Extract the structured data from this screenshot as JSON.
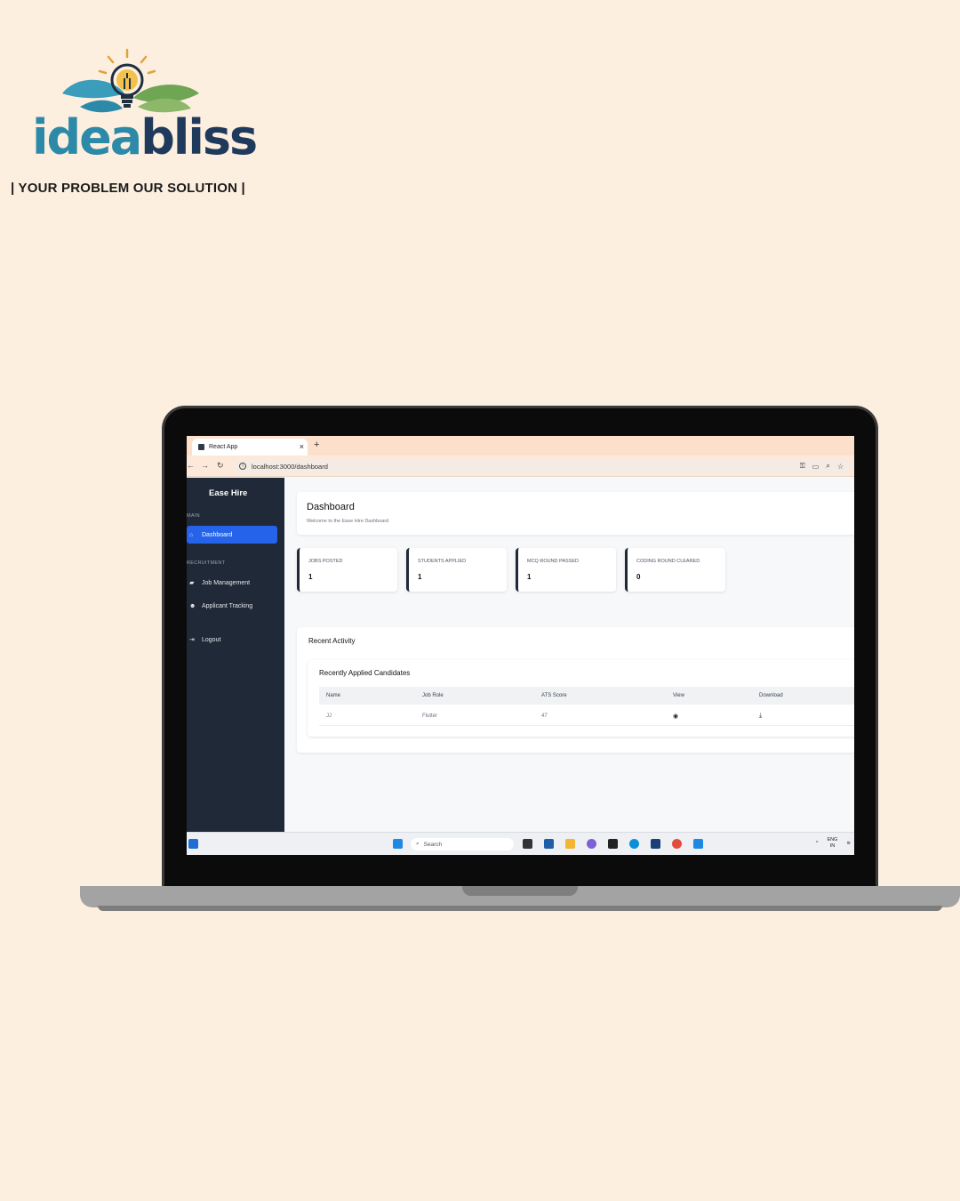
{
  "logo": {
    "word_part1": "idea",
    "word_part2": "bliss",
    "tagline": "| YOUR PROBLEM OUR SOLUTION |"
  },
  "browser": {
    "tab_title": "React App",
    "url": "localhost:3000/dashboard"
  },
  "sidebar": {
    "brand": "Ease Hire",
    "section_main": "MAIN",
    "section_recruitment": "RECRUITMENT",
    "items": [
      {
        "label": "Dashboard",
        "icon": "home-icon"
      },
      {
        "label": "Job Management",
        "icon": "briefcase-icon"
      },
      {
        "label": "Applicant Tracking",
        "icon": "users-icon"
      },
      {
        "label": "Logout",
        "icon": "logout-icon"
      }
    ]
  },
  "header": {
    "title": "Dashboard",
    "subtitle": "Welcome to the Ease Hire Dashboard"
  },
  "stats": [
    {
      "label": "JOBS POSTED",
      "value": "1"
    },
    {
      "label": "STUDENTS APPLIED",
      "value": "1"
    },
    {
      "label": "MCQ ROUND PASSED",
      "value": "1"
    },
    {
      "label": "CODING ROUND CLEARED",
      "value": "0"
    }
  ],
  "activity": {
    "title": "Recent Activity",
    "table_title": "Recently Applied Candidates",
    "columns": [
      "Name",
      "Job Role",
      "ATS Score",
      "View",
      "Download"
    ],
    "rows": [
      {
        "name": "JJ",
        "job_role": "Flutter",
        "ats_score": "47"
      }
    ]
  },
  "taskbar": {
    "search_placeholder": "Search",
    "lang": "ENG",
    "region": "IN"
  },
  "colors": {
    "accent": "#2563eb",
    "sidebar": "#1f2937",
    "background": "#fdefe0"
  }
}
